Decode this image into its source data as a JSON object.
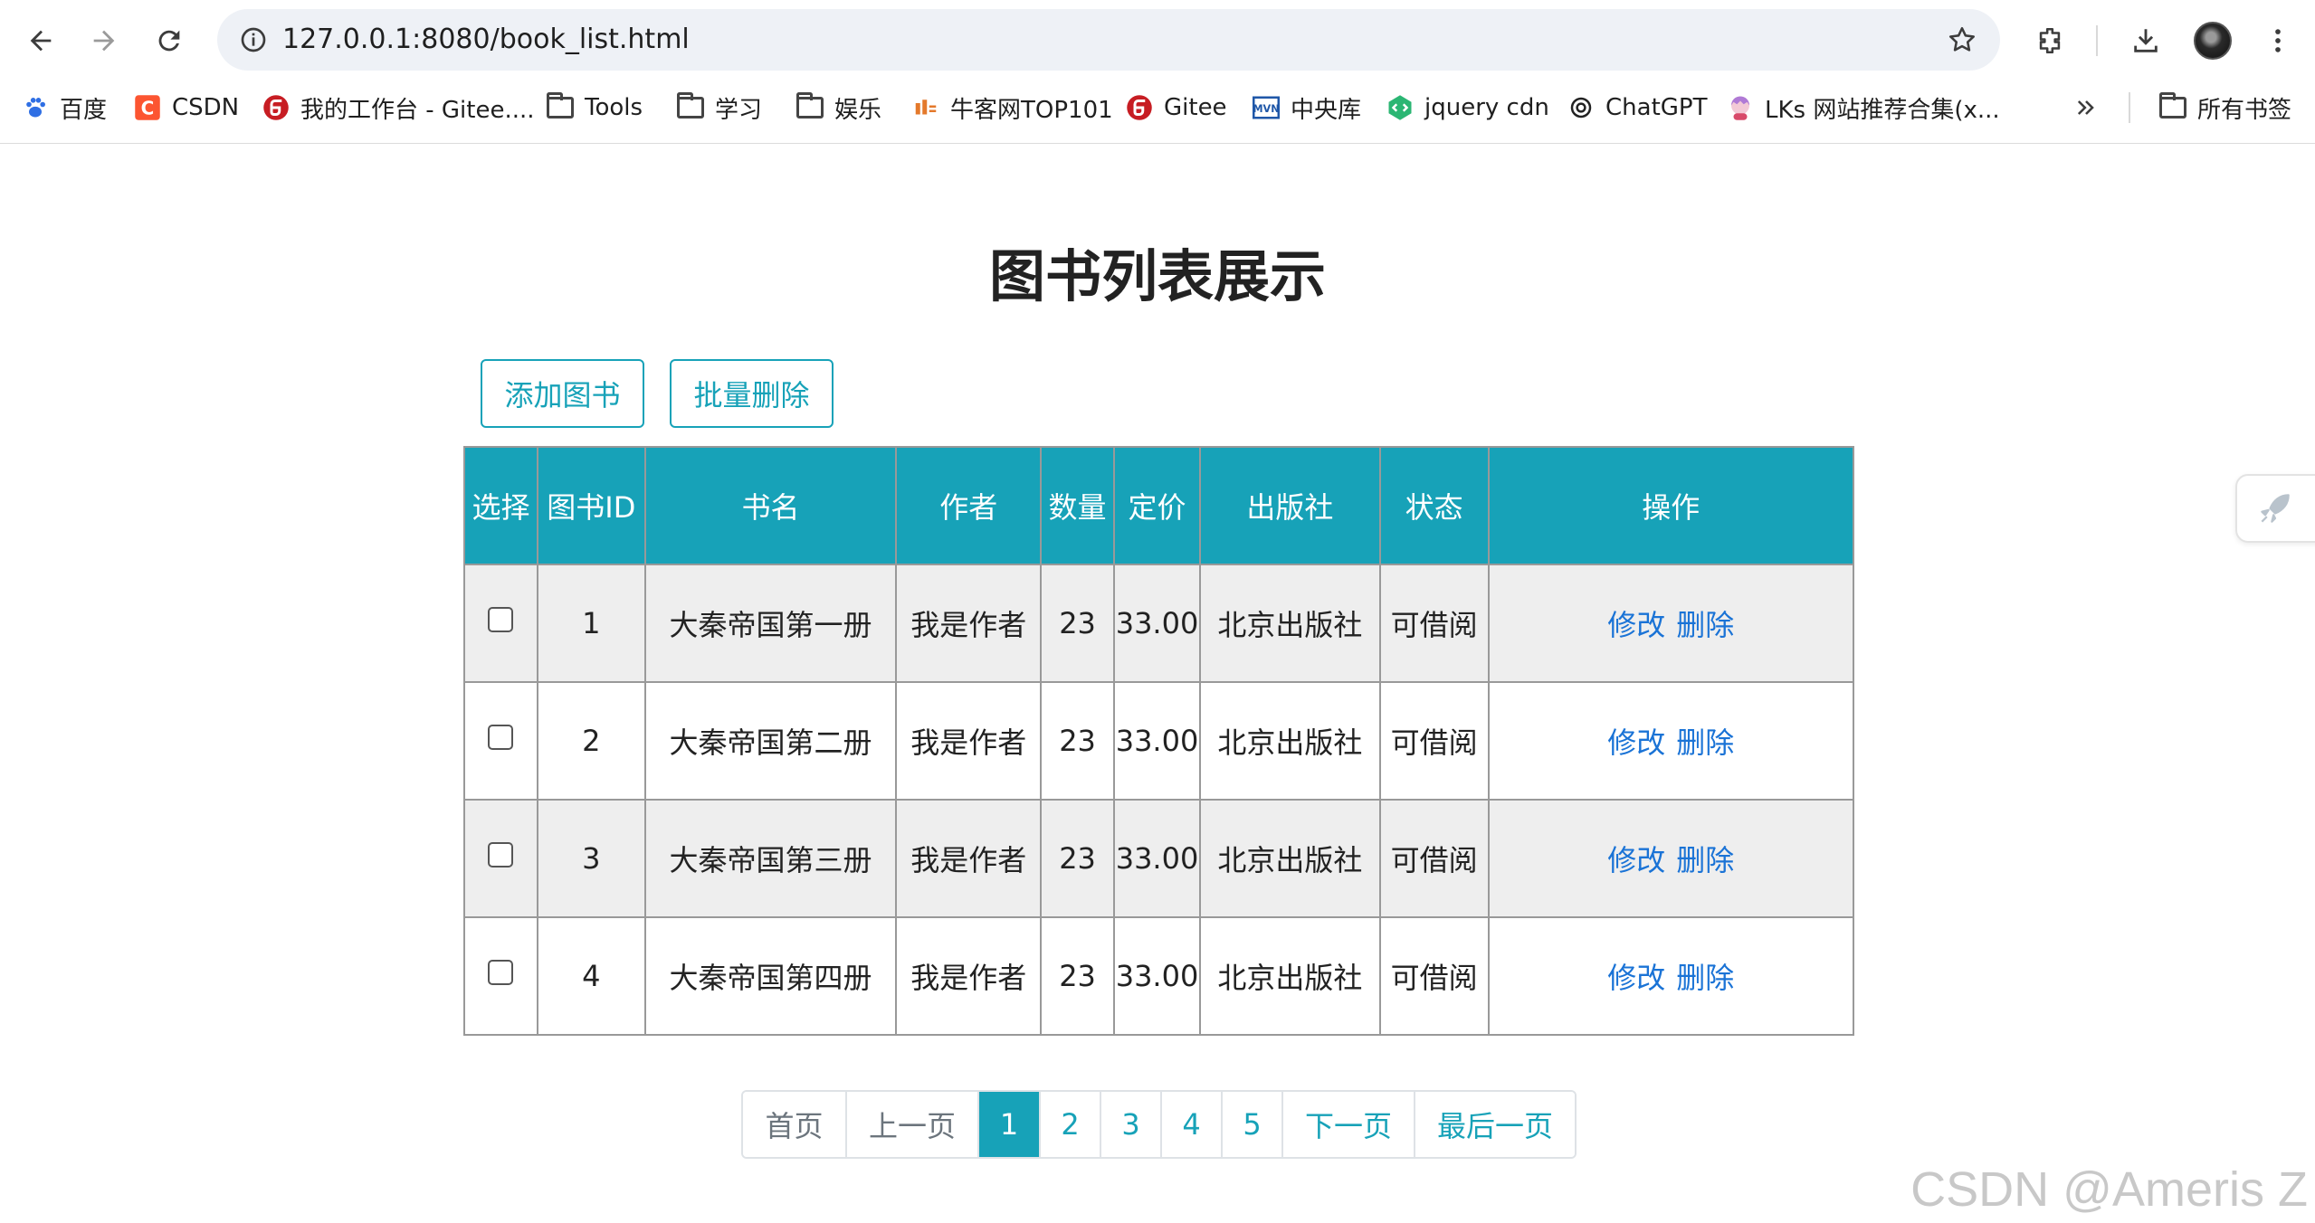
{
  "browser": {
    "url": "127.0.0.1:8080/book_list.html",
    "bookmarks": [
      {
        "label": "百度",
        "icon": "baidu-paw-icon"
      },
      {
        "label": "CSDN",
        "icon": "csdn-icon"
      },
      {
        "label": "我的工作台 - Gitee....",
        "icon": "gitee-icon"
      },
      {
        "label": "Tools",
        "icon": "folder-icon"
      },
      {
        "label": "学习",
        "icon": "folder-icon"
      },
      {
        "label": "娱乐",
        "icon": "folder-icon"
      },
      {
        "label": "牛客网TOP101",
        "icon": "nowcoder-icon"
      },
      {
        "label": "Gitee",
        "icon": "gitee-icon"
      },
      {
        "label": "中央库",
        "icon": "maven-icon"
      },
      {
        "label": "jquery cdn",
        "icon": "jquery-cdn-icon"
      },
      {
        "label": "ChatGPT",
        "icon": "chatgpt-icon"
      },
      {
        "label": "LKs 网站推荐合集(x...",
        "icon": "anime-avatar-icon"
      }
    ],
    "all_bookmarks_label": "所有书签"
  },
  "page": {
    "title": "图书列表展示",
    "add_button": "添加图书",
    "batch_delete_button": "批量删除"
  },
  "table": {
    "headers": [
      "选择",
      "图书ID",
      "书名",
      "作者",
      "数量",
      "定价",
      "出版社",
      "状态",
      "操作"
    ],
    "rows": [
      {
        "id": "1",
        "name": "大秦帝国第一册",
        "author": "我是作者",
        "count": "23",
        "price": "33.00",
        "publisher": "北京出版社",
        "status": "可借阅",
        "edit": "修改",
        "delete": "删除"
      },
      {
        "id": "2",
        "name": "大秦帝国第二册",
        "author": "我是作者",
        "count": "23",
        "price": "33.00",
        "publisher": "北京出版社",
        "status": "可借阅",
        "edit": "修改",
        "delete": "删除"
      },
      {
        "id": "3",
        "name": "大秦帝国第三册",
        "author": "我是作者",
        "count": "23",
        "price": "33.00",
        "publisher": "北京出版社",
        "status": "可借阅",
        "edit": "修改",
        "delete": "删除"
      },
      {
        "id": "4",
        "name": "大秦帝国第四册",
        "author": "我是作者",
        "count": "23",
        "price": "33.00",
        "publisher": "北京出版社",
        "status": "可借阅",
        "edit": "修改",
        "delete": "删除"
      }
    ]
  },
  "pagination": {
    "first": "首页",
    "prev": "上一页",
    "pages": [
      "1",
      "2",
      "3",
      "4",
      "5"
    ],
    "active_page": "1",
    "next": "下一页",
    "last": "最后一页"
  },
  "watermark": "CSDN @Ameris Z",
  "colors": {
    "accent": "#17a2b8",
    "link": "#1a73d6",
    "row_alt": "#eeeeee"
  }
}
